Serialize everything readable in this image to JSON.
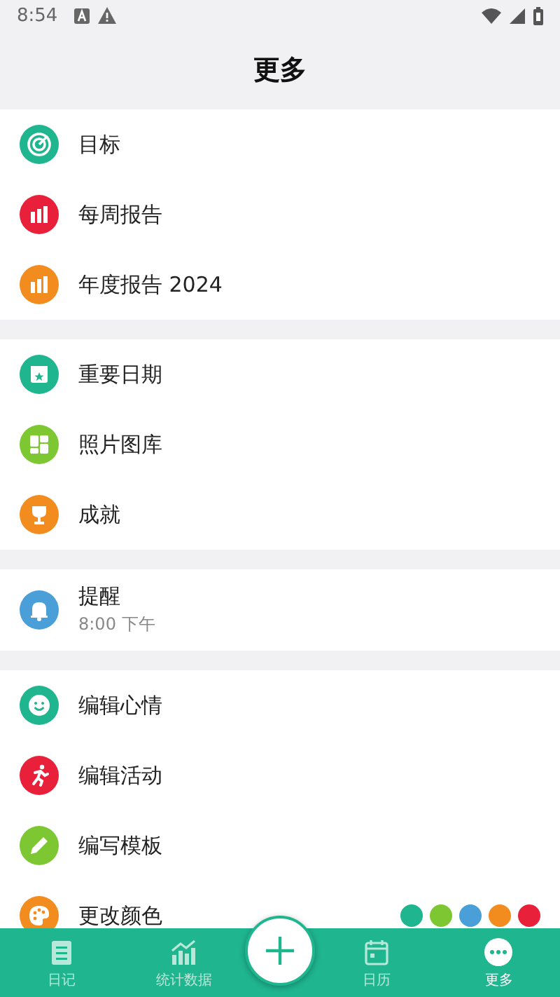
{
  "status_bar": {
    "time": "8:54"
  },
  "title": "更多",
  "sections": [
    {
      "items": [
        {
          "kind": "target",
          "color": "#1fb58f",
          "label": "目标"
        },
        {
          "kind": "bars",
          "color": "#e8203a",
          "label": "每周报告"
        },
        {
          "kind": "bars",
          "color": "#f28c1e",
          "label": "年度报告 2024"
        }
      ]
    },
    {
      "items": [
        {
          "kind": "calendar",
          "color": "#1fb58f",
          "label": "重要日期"
        },
        {
          "kind": "grid",
          "color": "#7dc832",
          "label": "照片图库"
        },
        {
          "kind": "trophy",
          "color": "#f28c1e",
          "label": "成就"
        }
      ]
    },
    {
      "items": [
        {
          "kind": "bell",
          "color": "#4a9fd8",
          "label": "提醒",
          "subtitle": "8:00 下午"
        }
      ]
    },
    {
      "items": [
        {
          "kind": "smile",
          "color": "#1fb58f",
          "label": "编辑心情"
        },
        {
          "kind": "runner",
          "color": "#e8203a",
          "label": "编辑活动"
        },
        {
          "kind": "pencil",
          "color": "#7dc832",
          "label": "编写模板"
        },
        {
          "kind": "palette",
          "color": "#f28c1e",
          "label": "更改颜色",
          "swatches": [
            {
              "color": "#1fb58f"
            },
            {
              "color": "#7dc832"
            },
            {
              "color": "#4a9fd8"
            },
            {
              "color": "#f28c1e"
            },
            {
              "color": "#e8203a"
            }
          ]
        }
      ]
    }
  ],
  "nav": [
    {
      "kind": "diary",
      "label": "日记",
      "selected": false
    },
    {
      "kind": "stats",
      "label": "统计数据",
      "selected": false
    },
    {
      "kind": "calendar",
      "label": "日历",
      "selected": false
    },
    {
      "kind": "more",
      "label": "更多",
      "selected": true
    }
  ]
}
